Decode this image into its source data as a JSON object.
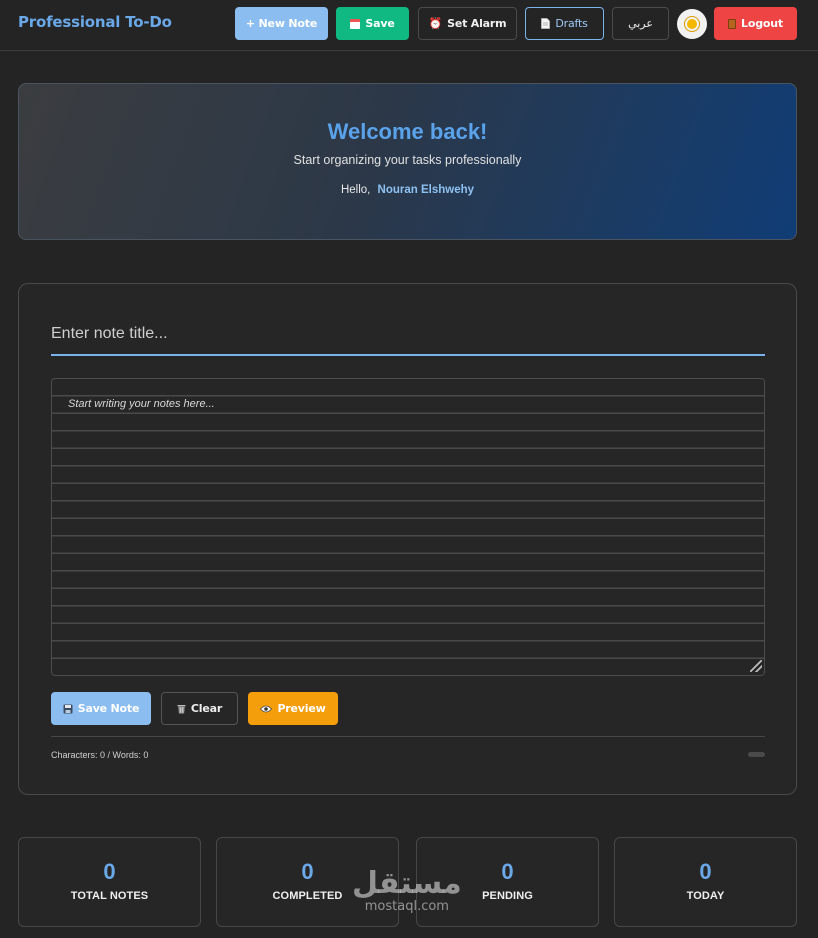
{
  "header": {
    "brand": "Professional To-Do",
    "new_note": "+ New Note",
    "save": "Save",
    "set_alarm": "Set Alarm",
    "drafts": "Drafts",
    "language": "عربي",
    "logout": "Logout"
  },
  "welcome": {
    "title": "Welcome back!",
    "subtitle": "Start organizing your tasks professionally",
    "hello": "Hello,",
    "user_name": "Nouran Elshwehy"
  },
  "editor": {
    "title_placeholder": "Enter note title...",
    "title_value": "",
    "notes_placeholder": "Start writing your notes here...",
    "notes_value": "",
    "save_note": "Save Note",
    "clear": "Clear",
    "preview": "Preview",
    "counts": "Characters: 0 / Words: 0"
  },
  "stats": [
    {
      "value": "0",
      "label": "TOTAL NOTES"
    },
    {
      "value": "0",
      "label": "COMPLETED"
    },
    {
      "value": "0",
      "label": "PENDING"
    },
    {
      "value": "0",
      "label": "TODAY"
    }
  ],
  "watermark": {
    "arabic": "مستقل",
    "latin": "mostaql.com"
  },
  "colors": {
    "accent": "#6aa8e8",
    "save_green": "#10b981",
    "logout_red": "#ef4444",
    "preview_orange": "#f59e0b",
    "background": "#242424"
  },
  "icons": {
    "save": "calendar-icon",
    "set_alarm": "alarm-clock-icon",
    "drafts": "document-icon",
    "theme": "sun-icon",
    "logout": "door-icon",
    "save_note": "floppy-disk-icon",
    "clear": "trash-icon",
    "preview": "eye-icon"
  }
}
